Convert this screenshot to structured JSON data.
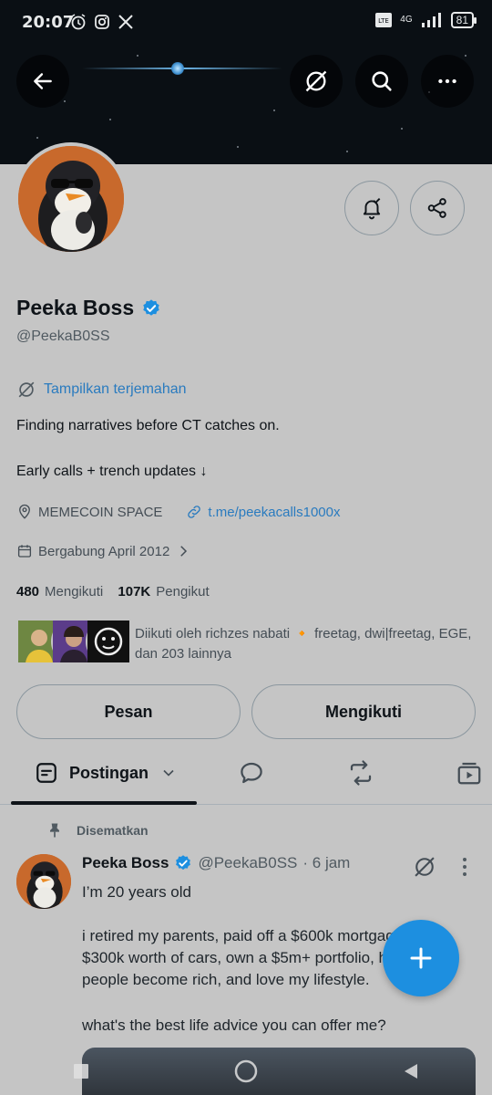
{
  "status_bar": {
    "time": "20:07",
    "icons": [
      "alarm-icon",
      "instagram-icon",
      "x-icon"
    ],
    "network": "4G",
    "battery": "81"
  },
  "header": {
    "back_icon": "arrow-left-icon",
    "translate_icon": "translate-off-icon",
    "search_icon": "search-icon",
    "more_icon": "more-horizontal-icon"
  },
  "profile": {
    "name": "Peeka Boss",
    "handle": "@PeekaB0SS",
    "verified": true,
    "translate_label": "Tampilkan terjemahan",
    "bio_line1": "Finding narratives before CT catches on.",
    "bio_line2": "Early calls + trench updates ↓",
    "location": "MEMECOIN SPACE",
    "link": "t.me/peekacalls1000x",
    "joined": "Bergabung April 2012",
    "following_count": "480",
    "following_label": "Mengikuti",
    "followers_count": "107K",
    "followers_label": "Pengikut",
    "followed_by_text": "Diikuti oleh richzes nabati 🔸 freetag, dwi|freetag, EGE, dan 203 lainnya",
    "message_button": "Pesan",
    "following_button": "Mengikuti"
  },
  "tabs": {
    "active_label": "Postingan",
    "others": [
      "replies-icon",
      "reposts-icon",
      "media-icon"
    ]
  },
  "tweet": {
    "pinned_label": "Disematkan",
    "author": "Peeka Boss",
    "handle": "@PeekaB0SS",
    "time": "· 6 jam",
    "line1": "I’m 20 years old",
    "line2": "i retired my parents, paid off a $600k mortgage,",
    "line3": "$300k worth of cars, own a $5m+ portfolio, help",
    "line4": "people become rich, and love my lifestyle.",
    "question": "what's the best life advice you can offer me?"
  },
  "colors": {
    "accent": "#1d8fe0",
    "link": "#2a7bbf",
    "background": "#c5c5c5"
  }
}
